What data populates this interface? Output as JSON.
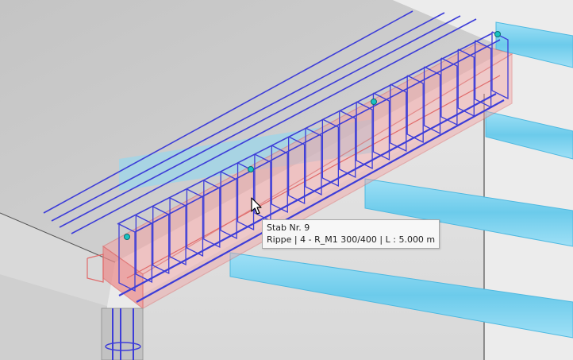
{
  "viewport": {
    "background_color": "#e9e9e9",
    "slab_color": "#c9c9c9",
    "beam_color": "#7fd3f0",
    "rebar_color": "#3d3dd8",
    "member_highlight_color": "#f08a8a",
    "node_color": "#19c3c3"
  },
  "tooltip": {
    "title": "Stab Nr. 9",
    "details": "Rippe | 4 - R_M1 300/400 | L : 5.000 m"
  },
  "cursor": {
    "icon": "arrow-pointer-icon"
  }
}
